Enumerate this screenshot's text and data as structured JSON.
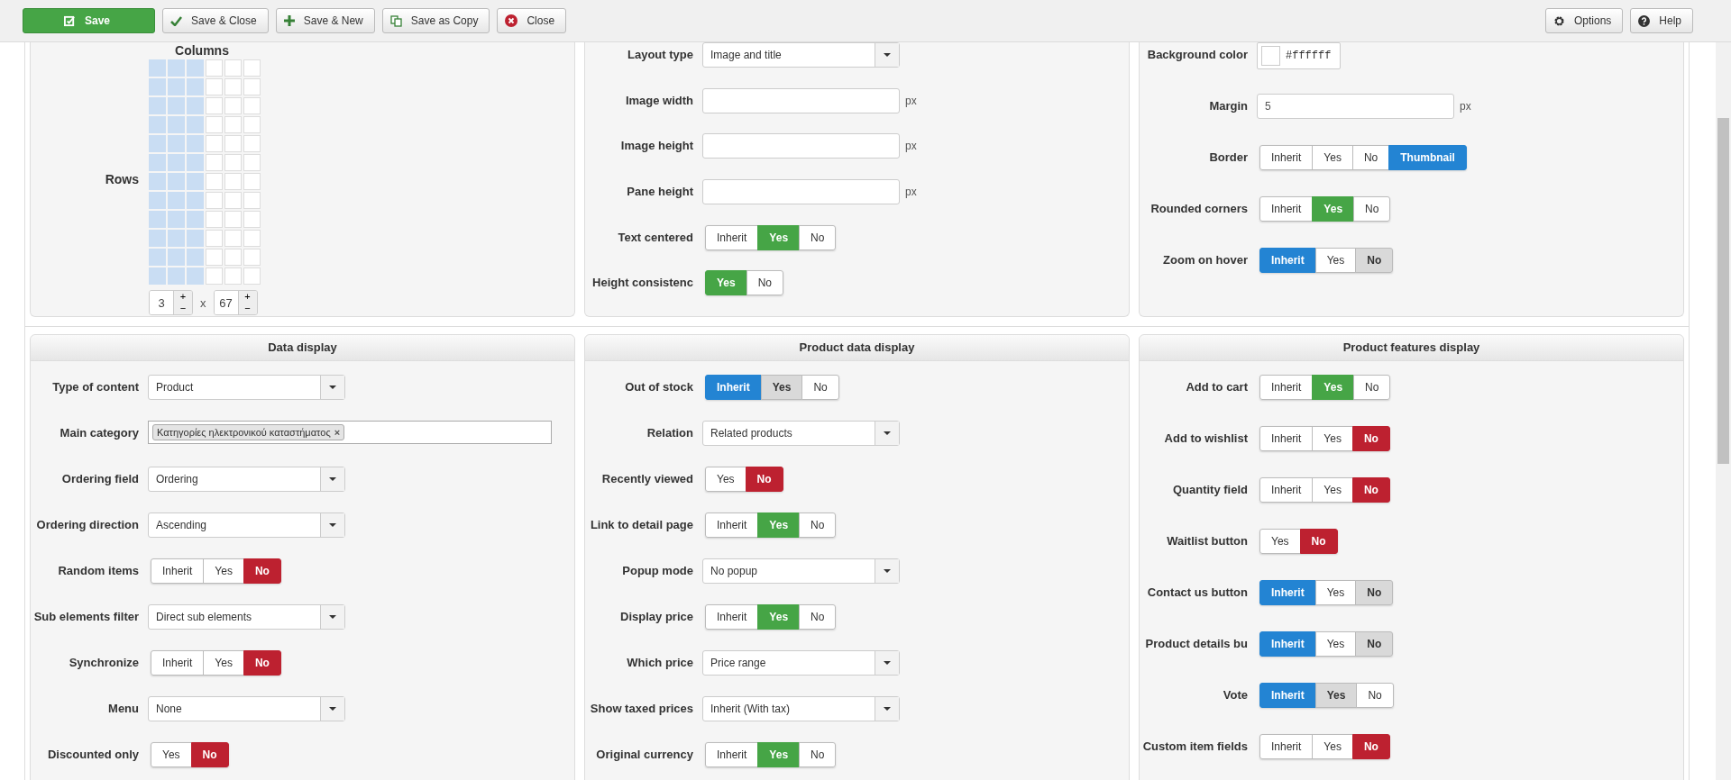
{
  "toolbar": {
    "buttons": [
      {
        "label": "Save",
        "kind": "primary"
      },
      {
        "label": "Save & Close",
        "kind": "default"
      },
      {
        "label": "Save & New",
        "kind": "default"
      },
      {
        "label": "Save as Copy",
        "kind": "default"
      },
      {
        "label": "Close",
        "kind": "default"
      }
    ],
    "right_buttons": [
      {
        "label": "Options"
      },
      {
        "label": "Help"
      }
    ]
  },
  "sections": [
    {
      "panels": [
        {
          "kind": "grid",
          "columns_label": "Columns",
          "rows_label": "Rows",
          "separator": "x",
          "cells": [
            [
              true,
              true,
              true,
              false,
              false,
              false
            ],
            [
              true,
              true,
              true,
              false,
              false,
              false
            ],
            [
              true,
              true,
              true,
              false,
              false,
              false
            ],
            [
              true,
              true,
              true,
              false,
              false,
              false
            ],
            [
              true,
              true,
              true,
              false,
              false,
              false
            ],
            [
              true,
              true,
              true,
              false,
              false,
              false
            ],
            [
              true,
              true,
              true,
              false,
              false,
              false
            ],
            [
              true,
              true,
              true,
              false,
              false,
              false
            ],
            [
              true,
              true,
              true,
              false,
              false,
              false
            ],
            [
              true,
              true,
              true,
              false,
              false,
              false
            ],
            [
              true,
              true,
              true,
              false,
              false,
              false
            ],
            [
              true,
              true,
              true,
              false,
              false,
              false
            ]
          ],
          "spinners": [
            {
              "value": "3",
              "plus": "+",
              "minus": "−"
            },
            {
              "value": "67",
              "plus": "+",
              "minus": "−"
            }
          ]
        },
        {
          "kind": "form",
          "rows": [
            {
              "label": "Layout type",
              "kind": "select",
              "value": "Image and title"
            },
            {
              "label": "Image width",
              "kind": "text",
              "unit": "px"
            },
            {
              "label": "Image height",
              "kind": "text",
              "unit": "px"
            },
            {
              "label": "Pane height",
              "kind": "text",
              "unit": "px"
            },
            {
              "label": "Text centered",
              "kind": "toggle",
              "options": [
                {
                  "label": "Inherit",
                  "selected": false,
                  "inherited": false
                },
                {
                  "label": "Yes",
                  "selected": true,
                  "inherited": false,
                  "color": "#46a546"
                },
                {
                  "label": "No",
                  "selected": false,
                  "inherited": false
                }
              ]
            },
            {
              "label": "Height consistenc",
              "kind": "toggle",
              "options": [
                {
                  "label": "Yes",
                  "selected": true,
                  "inherited": false,
                  "color": "#46a546"
                },
                {
                  "label": "No",
                  "selected": false,
                  "inherited": false
                }
              ]
            }
          ]
        },
        {
          "kind": "form",
          "rows": [
            {
              "label": "Background color",
              "kind": "color",
              "value": "#ffffff"
            },
            {
              "label": "Margin",
              "kind": "text",
              "value": "5",
              "unit": "px"
            },
            {
              "label": "Border",
              "kind": "toggle",
              "options": [
                {
                  "label": "Inherit",
                  "selected": false,
                  "inherited": false
                },
                {
                  "label": "Yes",
                  "selected": false,
                  "inherited": false
                },
                {
                  "label": "No",
                  "selected": false,
                  "inherited": false
                },
                {
                  "label": "Thumbnail",
                  "selected": true,
                  "inherited": false,
                  "color": "#2384d3"
                }
              ]
            },
            {
              "label": "Rounded corners",
              "kind": "toggle",
              "options": [
                {
                  "label": "Inherit",
                  "selected": false,
                  "inherited": false
                },
                {
                  "label": "Yes",
                  "selected": true,
                  "inherited": false,
                  "color": "#46a546"
                },
                {
                  "label": "No",
                  "selected": false,
                  "inherited": false
                }
              ]
            },
            {
              "label": "Zoom on hover",
              "kind": "toggle",
              "options": [
                {
                  "label": "Inherit",
                  "selected": true,
                  "inherited": false,
                  "color": "#2384d3"
                },
                {
                  "label": "Yes",
                  "selected": false,
                  "inherited": false
                },
                {
                  "label": "No",
                  "selected": false,
                  "inherited": true
                }
              ]
            }
          ]
        }
      ]
    },
    {
      "panels": [
        {
          "kind": "form",
          "title": "Data display",
          "rows": [
            {
              "label": "Type of content",
              "kind": "select",
              "value": "Product"
            },
            {
              "label": "Main category",
              "kind": "tags",
              "tags": [
                {
                  "label": "Κατηγορίες ηλεκτρονικού καταστήματος",
                  "remove": "×"
                }
              ]
            },
            {
              "label": "Ordering field",
              "kind": "select",
              "value": "Ordering"
            },
            {
              "label": "Ordering direction",
              "kind": "select",
              "value": "Ascending"
            },
            {
              "label": "Random items",
              "kind": "toggle",
              "options": [
                {
                  "label": "Inherit",
                  "selected": false,
                  "inherited": false
                },
                {
                  "label": "Yes",
                  "selected": false,
                  "inherited": false
                },
                {
                  "label": "No",
                  "selected": true,
                  "inherited": false,
                  "color": "#bd2130"
                }
              ]
            },
            {
              "label": "Sub elements filter",
              "kind": "select",
              "value": "Direct sub elements"
            },
            {
              "label": "Synchronize",
              "kind": "toggle",
              "options": [
                {
                  "label": "Inherit",
                  "selected": false,
                  "inherited": false
                },
                {
                  "label": "Yes",
                  "selected": false,
                  "inherited": false
                },
                {
                  "label": "No",
                  "selected": true,
                  "inherited": false,
                  "color": "#bd2130"
                }
              ]
            },
            {
              "label": "Menu",
              "kind": "select",
              "value": "None"
            },
            {
              "label": "Discounted only",
              "kind": "toggle",
              "options": [
                {
                  "label": "Yes",
                  "selected": false,
                  "inherited": false
                },
                {
                  "label": "No",
                  "selected": true,
                  "inherited": false,
                  "color": "#bd2130"
                }
              ]
            }
          ]
        },
        {
          "kind": "form",
          "title": "Product data display",
          "rows": [
            {
              "label": "Out of stock",
              "kind": "toggle",
              "options": [
                {
                  "label": "Inherit",
                  "selected": true,
                  "inherited": false,
                  "color": "#2384d3"
                },
                {
                  "label": "Yes",
                  "selected": false,
                  "inherited": true
                },
                {
                  "label": "No",
                  "selected": false,
                  "inherited": false
                }
              ]
            },
            {
              "label": "Relation",
              "kind": "select",
              "value": "Related products"
            },
            {
              "label": "Recently viewed",
              "kind": "toggle",
              "options": [
                {
                  "label": "Yes",
                  "selected": false,
                  "inherited": false
                },
                {
                  "label": "No",
                  "selected": true,
                  "inherited": false,
                  "color": "#bd2130"
                }
              ]
            },
            {
              "label": "Link to detail page",
              "kind": "toggle",
              "options": [
                {
                  "label": "Inherit",
                  "selected": false,
                  "inherited": false
                },
                {
                  "label": "Yes",
                  "selected": true,
                  "inherited": false,
                  "color": "#46a546"
                },
                {
                  "label": "No",
                  "selected": false,
                  "inherited": false
                }
              ]
            },
            {
              "label": "Popup mode",
              "kind": "select",
              "value": "No popup"
            },
            {
              "label": "Display price",
              "kind": "toggle",
              "options": [
                {
                  "label": "Inherit",
                  "selected": false,
                  "inherited": false
                },
                {
                  "label": "Yes",
                  "selected": true,
                  "inherited": false,
                  "color": "#46a546"
                },
                {
                  "label": "No",
                  "selected": false,
                  "inherited": false
                }
              ]
            },
            {
              "label": "Which price",
              "kind": "select",
              "value": "Price range"
            },
            {
              "label": "Show taxed prices",
              "kind": "select",
              "value": "Inherit (With tax)"
            },
            {
              "label": "Original currency",
              "kind": "toggle",
              "options": [
                {
                  "label": "Inherit",
                  "selected": false,
                  "inherited": false
                },
                {
                  "label": "Yes",
                  "selected": true,
                  "inherited": false,
                  "color": "#46a546"
                },
                {
                  "label": "No",
                  "selected": false,
                  "inherited": false
                }
              ]
            }
          ]
        },
        {
          "kind": "form",
          "title": "Product features display",
          "rows": [
            {
              "label": "Add to cart",
              "kind": "toggle",
              "options": [
                {
                  "label": "Inherit",
                  "selected": false,
                  "inherited": false
                },
                {
                  "label": "Yes",
                  "selected": true,
                  "inherited": false,
                  "color": "#46a546"
                },
                {
                  "label": "No",
                  "selected": false,
                  "inherited": false
                }
              ]
            },
            {
              "label": "Add to wishlist",
              "kind": "toggle",
              "options": [
                {
                  "label": "Inherit",
                  "selected": false,
                  "inherited": false
                },
                {
                  "label": "Yes",
                  "selected": false,
                  "inherited": false
                },
                {
                  "label": "No",
                  "selected": true,
                  "inherited": false,
                  "color": "#bd2130"
                }
              ]
            },
            {
              "label": "Quantity field",
              "kind": "toggle",
              "options": [
                {
                  "label": "Inherit",
                  "selected": false,
                  "inherited": false
                },
                {
                  "label": "Yes",
                  "selected": false,
                  "inherited": false
                },
                {
                  "label": "No",
                  "selected": true,
                  "inherited": false,
                  "color": "#bd2130"
                }
              ]
            },
            {
              "label": "Waitlist button",
              "kind": "toggle",
              "options": [
                {
                  "label": "Yes",
                  "selected": false,
                  "inherited": false
                },
                {
                  "label": "No",
                  "selected": true,
                  "inherited": false,
                  "color": "#bd2130"
                }
              ]
            },
            {
              "label": "Contact us button",
              "kind": "toggle",
              "options": [
                {
                  "label": "Inherit",
                  "selected": true,
                  "inherited": false,
                  "color": "#2384d3"
                },
                {
                  "label": "Yes",
                  "selected": false,
                  "inherited": false
                },
                {
                  "label": "No",
                  "selected": false,
                  "inherited": true
                }
              ]
            },
            {
              "label": "Product details bu",
              "kind": "toggle",
              "options": [
                {
                  "label": "Inherit",
                  "selected": true,
                  "inherited": false,
                  "color": "#2384d3"
                },
                {
                  "label": "Yes",
                  "selected": false,
                  "inherited": false
                },
                {
                  "label": "No",
                  "selected": false,
                  "inherited": true
                }
              ]
            },
            {
              "label": "Vote",
              "kind": "toggle",
              "options": [
                {
                  "label": "Inherit",
                  "selected": true,
                  "inherited": false,
                  "color": "#2384d3"
                },
                {
                  "label": "Yes",
                  "selected": false,
                  "inherited": true
                },
                {
                  "label": "No",
                  "selected": false,
                  "inherited": false
                }
              ]
            },
            {
              "label": "Custom item fields",
              "kind": "toggle",
              "options": [
                {
                  "label": "Inherit",
                  "selected": false,
                  "inherited": false
                },
                {
                  "label": "Yes",
                  "selected": false,
                  "inherited": false
                },
                {
                  "label": "No",
                  "selected": true,
                  "inherited": false,
                  "color": "#bd2130"
                }
              ]
            }
          ]
        }
      ]
    }
  ]
}
